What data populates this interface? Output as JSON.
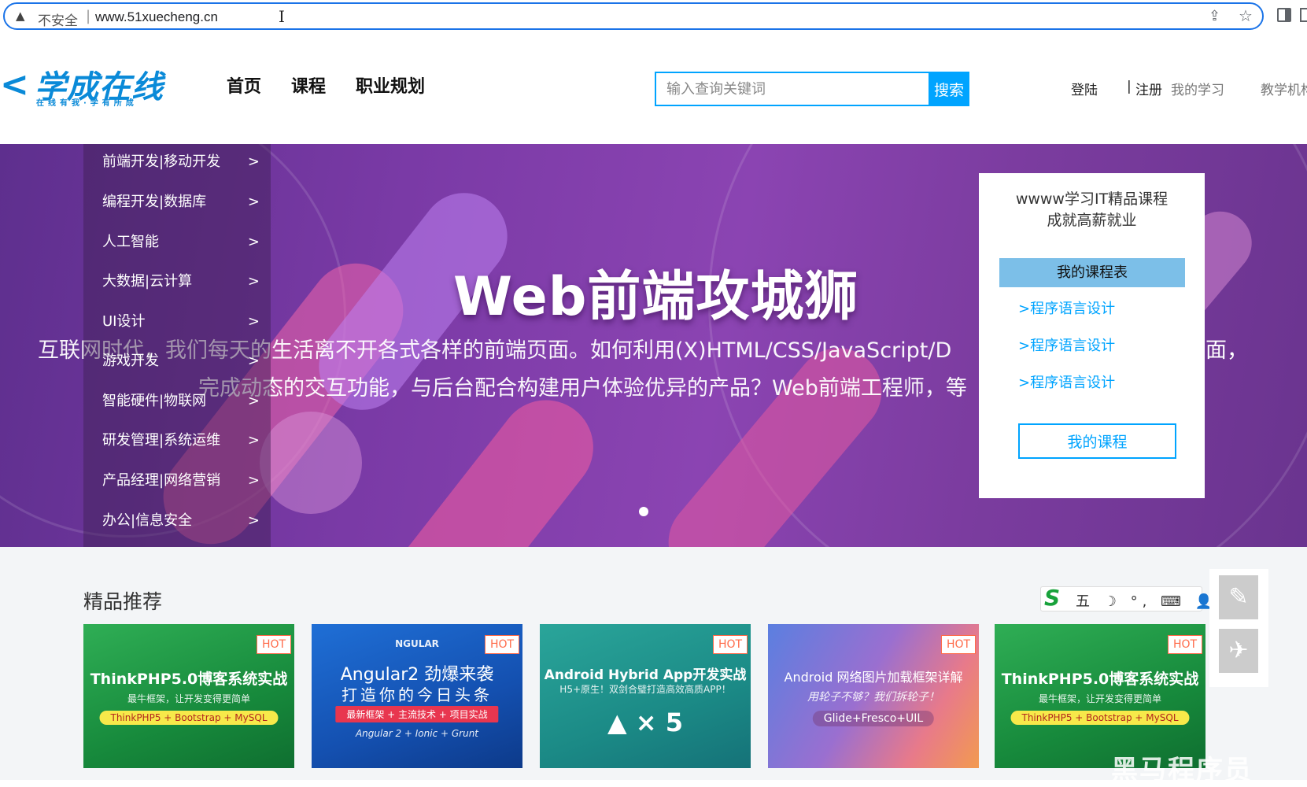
{
  "browser": {
    "insecure_label": "不安全",
    "separator": "|",
    "url": "www.51xuecheng.cn",
    "warning_icon": "warning-triangle-icon"
  },
  "header": {
    "logo_text": "学成在线",
    "logo_slogan": "在线有我·学有所成",
    "nav": [
      "首页",
      "课程",
      "职业规划"
    ],
    "search_placeholder": "输入查询关键词",
    "search_button": "搜索",
    "login": "登陆",
    "divider": "|",
    "register": "注册",
    "my_learning": "我的学习",
    "teaching": "教学机构"
  },
  "banner": {
    "title": "Web前端攻城狮",
    "line1": "互联网时代，我们每天的生活离不开各式各样的前端页面。如何利用(X)HTML/CSS/JavaScript/D",
    "line1_tail": "面，",
    "line2": "完成动态的交互功能，与后台配合构建用户体验优异的产品？Web前端工程师，等"
  },
  "categories": [
    {
      "label": "前端开发|移动开发",
      "arrow": ">"
    },
    {
      "label": "编程开发|数据库",
      "arrow": ">"
    },
    {
      "label": "人工智能",
      "arrow": ">"
    },
    {
      "label": "大数据|云计算",
      "arrow": ">"
    },
    {
      "label": "UI设计",
      "arrow": ">"
    },
    {
      "label": "游戏开发",
      "arrow": ">"
    },
    {
      "label": "智能硬件|物联网",
      "arrow": ">"
    },
    {
      "label": "研发管理|系统运维",
      "arrow": ">"
    },
    {
      "label": "产品经理|网络营销",
      "arrow": ">"
    },
    {
      "label": "办公|信息安全",
      "arrow": ">"
    }
  ],
  "card": {
    "title": "wwww学习IT精品课程\n成就高薪就业",
    "schedule": "我的课程表",
    "links": [
      ">程序语言设计",
      ">程序语言设计",
      ">程序语言设计"
    ],
    "button": "我的课程"
  },
  "recommend": {
    "title": "精品推荐",
    "hot": "HOT",
    "courses": [
      {
        "title": "ThinkPHP5.0博客系统实战",
        "sub": "最牛框架，让开发变得更简单",
        "pill": "ThinkPHP5 + Bootstrap + MySQL"
      },
      {
        "title": "Angular2 劲爆来袭",
        "title2": "打造你的今日头条",
        "brand": "NGULAR",
        "sub": "最新框架 + 主流技术 + 项目实战",
        "pill": "Angular 2 + Ionic + Grunt"
      },
      {
        "title": "Android Hybrid App开发实战",
        "sub": "H5+原生！双剑合璧打造高效高质APP！",
        "pill": "×"
      },
      {
        "title": "Android 网络图片加载框架详解",
        "sub": "用轮子不够？我们拆轮子！",
        "pill": "Glide+Fresco+UIL"
      },
      {
        "title": "ThinkPHP5.0博客系统实战",
        "sub": "最牛框架，让开发变得更简单",
        "pill": "ThinkPHP5 + Bootstrap + MySQL"
      }
    ],
    "ime_keys": "五 ☽ °, ⌨ 👤 ⁘",
    "watermark": "黑马程序员"
  },
  "colors": {
    "accent": "#00a4ff",
    "banner_purple": "#7a3aa6",
    "hot": "#ff6b4a"
  }
}
